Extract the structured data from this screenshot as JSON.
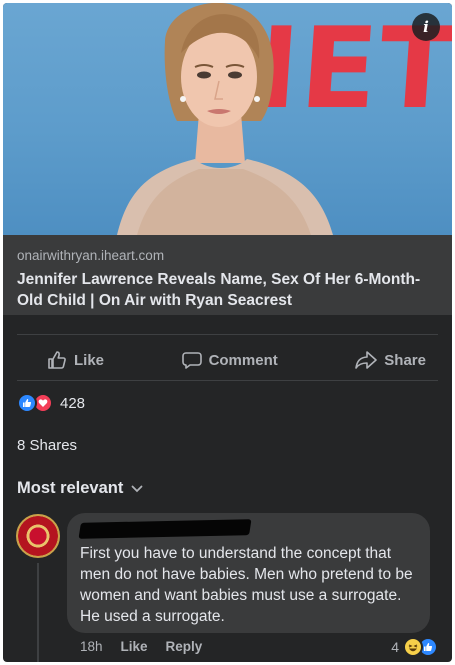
{
  "link_preview": {
    "domain": "onairwithryan.iheart.com",
    "title": "Jennifer Lawrence Reveals Name, Sex Of Her 6-Month-Old Child | On Air with Ryan Seacrest",
    "backdrop_text": "NET",
    "info_icon": "i"
  },
  "actions": {
    "like": "Like",
    "comment": "Comment",
    "share": "Share"
  },
  "reactions": {
    "types": [
      "like-icon",
      "love-icon"
    ],
    "count": "428"
  },
  "shares": "8 Shares",
  "sort": {
    "label": "Most relevant",
    "icon": "chevron-down-icon"
  },
  "comment": {
    "author": "",
    "text": "First you have to understand the concept that men do not have babies. Men who pretend to be women and want babies must use a surrogate. He used a surrogate.",
    "time": "18h",
    "like": "Like",
    "reply": "Reply",
    "reaction_count": "4",
    "reaction_types": [
      "haha-icon",
      "like-icon"
    ]
  },
  "colors": {
    "surface": "#242526",
    "card": "#3a3b3c",
    "primary_text": "#e4e6eb",
    "secondary_text": "#b0b3b8",
    "like_blue": "#2d88ff",
    "love_red": "#f33e58",
    "backdrop_red": "#e53946"
  }
}
